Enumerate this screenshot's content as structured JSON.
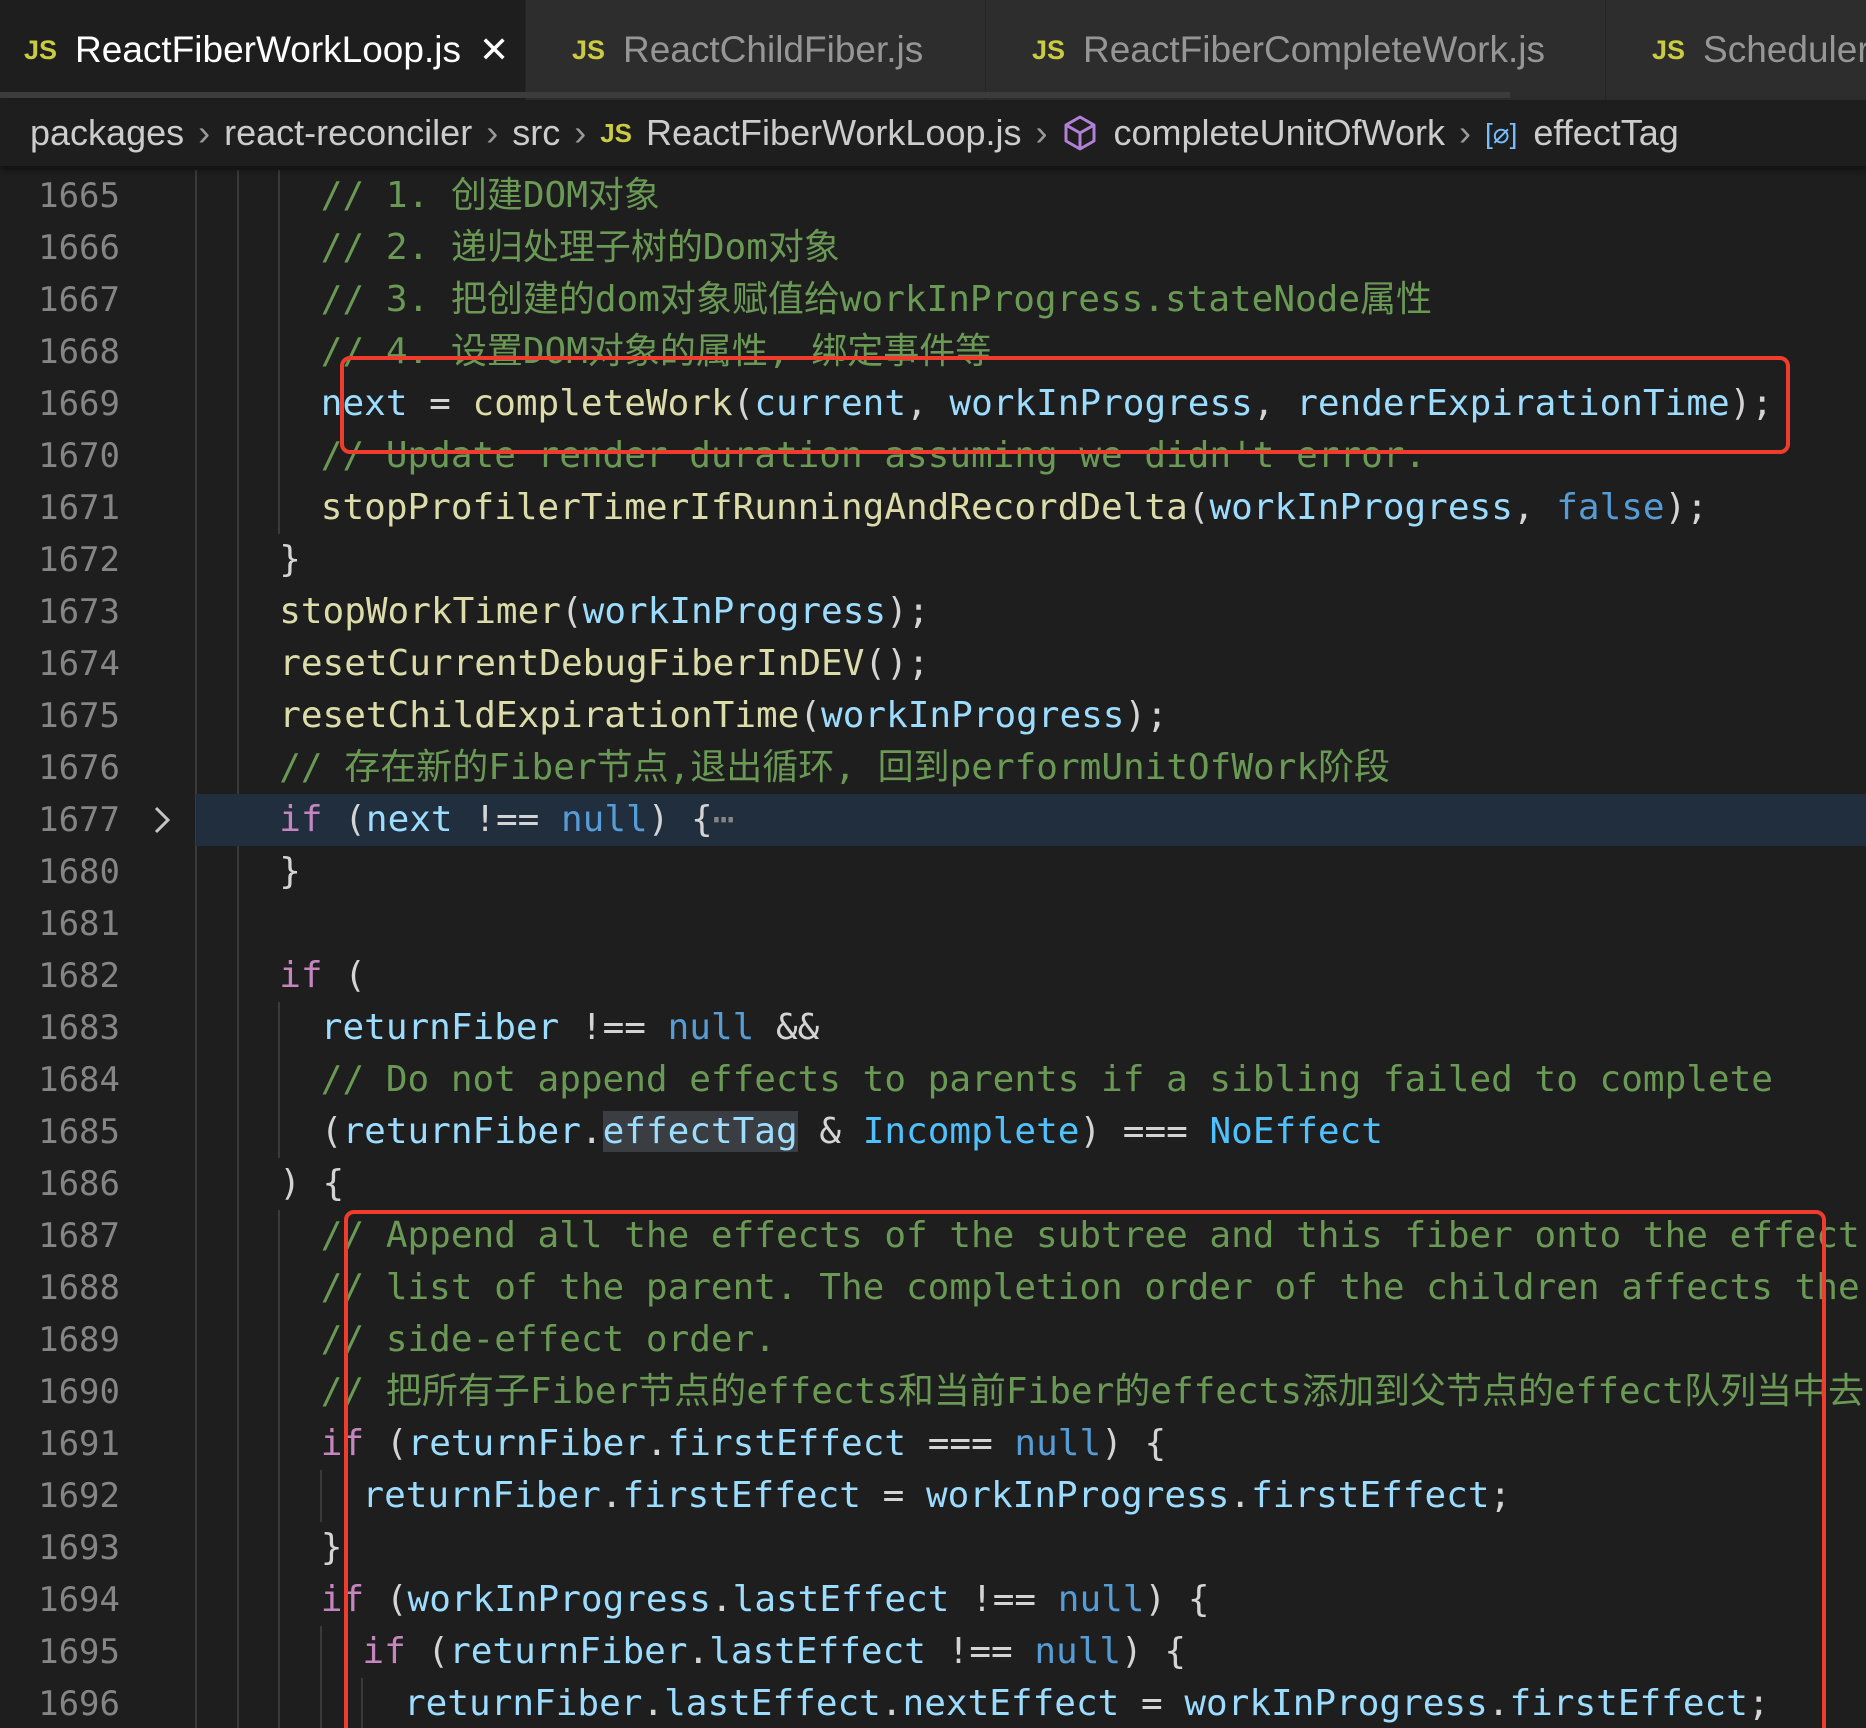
{
  "tabs": [
    {
      "label": "ReactFiberWorkLoop.js",
      "active": true
    },
    {
      "label": "ReactChildFiber.js",
      "active": false
    },
    {
      "label": "ReactFiberCompleteWork.js",
      "active": false
    },
    {
      "label": "Scheduler.js",
      "active": false
    }
  ],
  "breadcrumb": {
    "folders": [
      "packages",
      "react-reconciler",
      "src"
    ],
    "file": "ReactFiberWorkLoop.js",
    "function": "completeUnitOfWork",
    "symbol": "effectTag",
    "file_badge": "JS"
  },
  "icons": {
    "file_type": "js-icon",
    "tab_close": "close-icon",
    "function": "cube-icon",
    "variable": "variable-icon",
    "fold": "chevron-right-icon"
  },
  "colors": {
    "keyword": "#569cd6",
    "variable": "#9cdcfe",
    "function": "#dcdcaa",
    "comment": "#6a9955",
    "annotation_box": "#f03c2c"
  },
  "editor": {
    "folded_line": "1677",
    "lines": [
      {
        "num": "1665",
        "indent": 3,
        "text": "// 1. 创建DOM对象"
      },
      {
        "num": "1666",
        "indent": 3,
        "text": "// 2. 递归处理子树的Dom对象"
      },
      {
        "num": "1667",
        "indent": 3,
        "text": "// 3. 把创建的dom对象赋值给workInProgress.stateNode属性"
      },
      {
        "num": "1668",
        "indent": 3,
        "text": "// 4. 设置DOM对象的属性, 绑定事件等"
      },
      {
        "num": "1669",
        "indent": 3,
        "text": "next = completeWork(current, workInProgress, renderExpirationTime);"
      },
      {
        "num": "1670",
        "indent": 3,
        "text": "// Update render duration assuming we didn't error."
      },
      {
        "num": "1671",
        "indent": 3,
        "text": "stopProfilerTimerIfRunningAndRecordDelta(workInProgress, false);"
      },
      {
        "num": "1672",
        "indent": 2,
        "text": "}"
      },
      {
        "num": "1673",
        "indent": 2,
        "text": "stopWorkTimer(workInProgress);"
      },
      {
        "num": "1674",
        "indent": 2,
        "text": "resetCurrentDebugFiberInDEV();"
      },
      {
        "num": "1675",
        "indent": 2,
        "text": "resetChildExpirationTime(workInProgress);"
      },
      {
        "num": "1676",
        "indent": 2,
        "text": "// 存在新的Fiber节点,退出循环, 回到performUnitOfWork阶段"
      },
      {
        "num": "1677",
        "indent": 2,
        "text": "if (next !== null) {⋯"
      },
      {
        "num": "1680",
        "indent": 2,
        "text": "}"
      },
      {
        "num": "1681",
        "indent": 0,
        "text": ""
      },
      {
        "num": "1682",
        "indent": 2,
        "text": "if ("
      },
      {
        "num": "1683",
        "indent": 3,
        "text": "returnFiber !== null &&"
      },
      {
        "num": "1684",
        "indent": 3,
        "text": "// Do not append effects to parents if a sibling failed to complete"
      },
      {
        "num": "1685",
        "indent": 3,
        "text": "(returnFiber.effectTag & Incomplete) === NoEffect"
      },
      {
        "num": "1686",
        "indent": 2,
        "text": ") {"
      },
      {
        "num": "1687",
        "indent": 3,
        "text": "// Append all the effects of the subtree and this fiber onto the effect"
      },
      {
        "num": "1688",
        "indent": 3,
        "text": "// list of the parent. The completion order of the children affects the"
      },
      {
        "num": "1689",
        "indent": 3,
        "text": "// side-effect order."
      },
      {
        "num": "1690",
        "indent": 3,
        "text": "// 把所有子Fiber节点的effects和当前Fiber的effects添加到父节点的effect队列当中去"
      },
      {
        "num": "1691",
        "indent": 3,
        "text": "if (returnFiber.firstEffect === null) {"
      },
      {
        "num": "1692",
        "indent": 4,
        "text": "returnFiber.firstEffect = workInProgress.firstEffect;"
      },
      {
        "num": "1693",
        "indent": 3,
        "text": "}"
      },
      {
        "num": "1694",
        "indent": 3,
        "text": "if (workInProgress.lastEffect !== null) {"
      },
      {
        "num": "1695",
        "indent": 4,
        "text": "if (returnFiber.lastEffect !== null) {"
      },
      {
        "num": "1696",
        "indent": 5,
        "text": "returnFiber.lastEffect.nextEffect = workInProgress.firstEffect;"
      }
    ]
  }
}
